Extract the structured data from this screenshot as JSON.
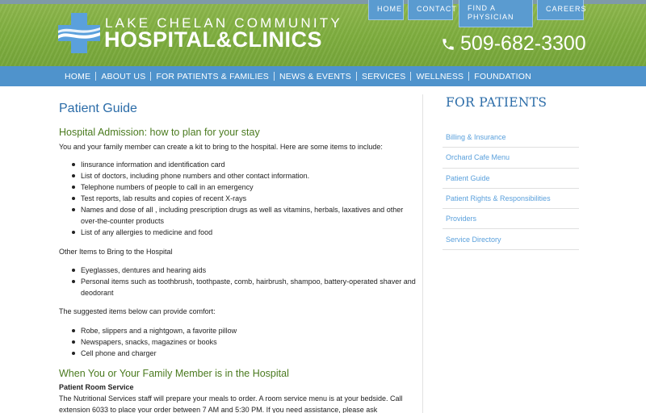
{
  "header": {
    "brand_line1": "LAKE CHELAN COMMUNITY",
    "brand_line2": "HOSPITAL&CLINICS",
    "phone": "509-682-3300",
    "top_links": [
      "HOME",
      "CONTACT",
      "FIND A",
      "PHYSICIAN",
      "CAREERS"
    ]
  },
  "nav": {
    "items": [
      "HOME",
      "ABOUT US",
      "FOR PATIENTS & FAMILIES",
      "NEWS & EVENTS",
      "SERVICES",
      "WELLNESS",
      "FOUNDATION"
    ]
  },
  "main": {
    "title": "Patient Guide",
    "section1": {
      "heading": "Hospital Admission: how to plan for your stay",
      "intro": "You and your family member can create a kit to bring to the hospital. Here are some items to include:",
      "items": [
        "Iinsurance information and identification card",
        "List of doctors, including phone numbers and other contact information.",
        "Telephone numbers of people to call in an emergency",
        "Test reports, lab results and copies of recent X-rays",
        "Names and dose of all , including prescription drugs as well as vitamins, herbals, laxatives and other over-the-counter products",
        "List of any allergies to medicine and food"
      ],
      "other_label": "Other Items to Bring to the Hospital",
      "other_items": [
        "Eyeglasses, dentures and hearing aids",
        "Personal items such as toothbrush, toothpaste, comb, hairbrush, shampoo, battery-operated shaver and deodorant"
      ],
      "comfort_label": "The suggested items below can provide comfort:",
      "comfort_items": [
        "Robe, slippers and a nightgown, a favorite pillow",
        "Newspapers, snacks, magazines or books",
        "Cell phone and charger"
      ]
    },
    "section2": {
      "heading": "When You or Your Family Member is in the Hospital",
      "subheading": "Patient Room Service",
      "text": "The Nutritional Services staff will prepare your meals to order. A room service menu is at your bedside. Call extension 6033 to place your order between 7 AM and 5:30 PM. If you need assistance, please ask"
    }
  },
  "sidebar": {
    "title": "FOR PATIENTS",
    "items": [
      "Billing & Insurance",
      "Orchard Cafe Menu",
      "Patient Guide",
      "Patient Rights & Responsibilities",
      "Providers",
      "Service Directory"
    ]
  }
}
